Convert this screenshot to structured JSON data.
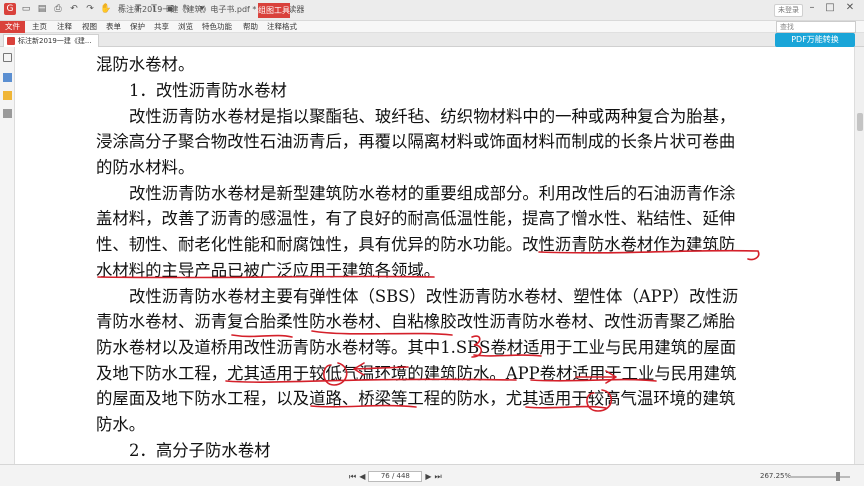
{
  "window": {
    "title": "标注新2019一建《建筑》电子书.pdf * - 福昕阅读器",
    "context_tab": "组图工具",
    "login": "未登录"
  },
  "menu": [
    "文件",
    "主页",
    "注释",
    "视图",
    "表单",
    "保护",
    "共享",
    "浏览",
    "特色功能",
    "帮助",
    "注释格式"
  ],
  "search": {
    "placeholder": "查找"
  },
  "tab": {
    "label": "标注新2019一建《建..."
  },
  "pdf_convert": "PDF万能转换",
  "document": {
    "lines": [
      "混防水卷材。",
      "1．改性沥青防水卷材",
      "改性沥青防水卷材是指以聚酯毡、玻纤毡、纺织物材料中的一种或两种复合为胎基，",
      "浸涂高分子聚合物改性石油沥青后，再覆以隔离材料或饰面材料而制成的长条片状可卷曲",
      "的防水材料。",
      "改性沥青防水卷材是新型建筑防水卷材的重要组成部分。利用改性后的石油沥青作涂",
      "盖材料，改善了沥青的感温性，有了良好的耐高低温性能，提高了憎水性、粘结性、延伸",
      "性、韧性、耐老化性能和耐腐蚀性，具有优异的防水功能。改性沥青防水卷材作为建筑防",
      "水材料的主导产品已被广泛应用于建筑各领域。",
      "改性沥青防水卷材主要有弹性体（SBS）改性沥青防水卷材、塑性体（APP）改性沥",
      "青防水卷材、沥青复合胎柔性防水卷材、自粘橡胶改性沥青防水卷材、改性沥青聚乙烯胎",
      "防水卷材以及道桥用改性沥青防水卷材等。其中1.SBS卷材适用于工业与民用建筑的屋面",
      "及地下防水工程，尤其适用于较低气温环境的建筑防水。APP卷材适用于工业与民用建筑",
      "的屋面及地下防水工程，以及道路、桥梁等工程的防水，尤其适用于较高气温环境的建筑",
      "防水。",
      "2．高分子防水卷材"
    ]
  },
  "status": {
    "page": "76 / 448",
    "zoom": "267.25%"
  },
  "colors": {
    "accent": "#d9413b",
    "ink": "#d4202a",
    "pdf_button": "#1aa5d8"
  }
}
